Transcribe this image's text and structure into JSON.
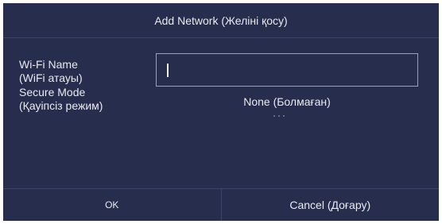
{
  "dialog": {
    "title": "Add Network (Желіні қосу)"
  },
  "fields": {
    "wifi_name": {
      "label_line1": "Wi-Fi Name",
      "label_line2": "(WiFi атауы)",
      "value": ""
    },
    "secure_mode": {
      "label_line1": "Secure Mode",
      "label_line2": "(Қауіпсіз режим)",
      "value": "None (Болмаған)"
    }
  },
  "buttons": {
    "ok_label": "OK",
    "cancel_label": "Cancel (Доғару)"
  },
  "colors": {
    "background": "#262d4d",
    "text": "#e8eaf2",
    "border": "#9aa0b8"
  }
}
